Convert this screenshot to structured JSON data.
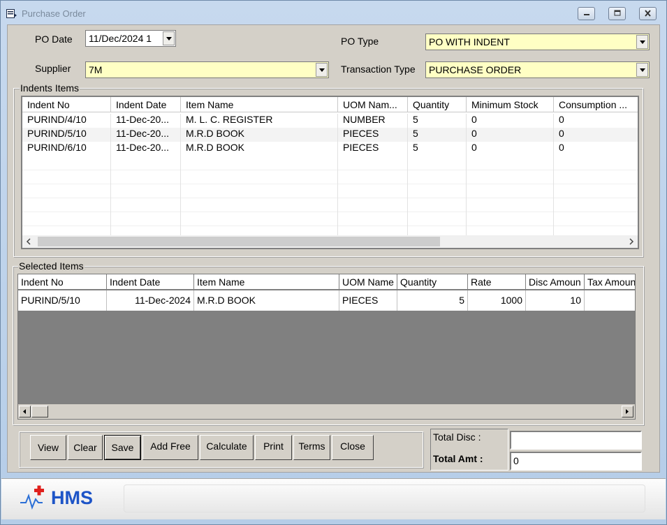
{
  "window": {
    "title": "Purchase Order"
  },
  "form": {
    "po_date_label": "PO Date",
    "po_date_value": "11/Dec/2024 1",
    "po_type_label": "PO Type",
    "po_type_value": "PO WITH INDENT",
    "supplier_label": "Supplier",
    "supplier_value": "7M",
    "transaction_type_label": "Transaction Type",
    "transaction_type_value": "PURCHASE ORDER"
  },
  "indents": {
    "title": "Indents Items",
    "headers": [
      "Indent No",
      "Indent Date",
      "Item Name",
      "UOM Nam...",
      "Quantity",
      "Minimum Stock",
      "Consumption ..."
    ],
    "rows": [
      [
        "PURIND/4/10",
        "11-Dec-20...",
        "M. L. C. REGISTER",
        "NUMBER",
        "5",
        "0",
        "0"
      ],
      [
        "PURIND/5/10",
        "11-Dec-20...",
        "M.R.D BOOK",
        "PIECES",
        "5",
        "0",
        "0"
      ],
      [
        "PURIND/6/10",
        "11-Dec-20...",
        "M.R.D BOOK",
        "PIECES",
        "5",
        "0",
        "0"
      ]
    ]
  },
  "selected": {
    "title": "Selected Items",
    "headers": [
      "Indent No",
      "Indent Date",
      "Item Name",
      "UOM Name",
      "Quantity",
      "Rate",
      "Disc Amoun",
      "Tax Amoun"
    ],
    "rows": [
      [
        "PURIND/5/10",
        "11-Dec-2024",
        "M.R.D BOOK",
        "PIECES",
        "5",
        "1000",
        "10",
        ""
      ]
    ]
  },
  "buttons": {
    "view": "View",
    "clear": "Clear",
    "save": "Save",
    "add_free": "Add Free",
    "calculate": "Calculate",
    "print": "Print",
    "terms": "Terms",
    "close": "Close"
  },
  "totals": {
    "disc_label": "Total Disc :",
    "disc_value": "",
    "amt_label": "Total Amt :",
    "amt_value": "0"
  },
  "footer": {
    "logo_text": "HMS"
  },
  "colors": {
    "highlight_yellow": "#ffffc4",
    "grid_bg": "#808080",
    "logo_blue": "#1d54c7",
    "logo_red": "#e0201c"
  }
}
